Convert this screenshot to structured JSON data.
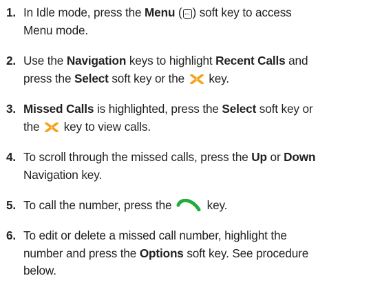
{
  "steps": [
    {
      "number": "1.",
      "t1": "In Idle mode, press the ",
      "b1": "Menu",
      "t2": " (",
      "t3": ") soft key to access",
      "t4": "Menu mode."
    },
    {
      "number": "2.",
      "t1": "Use the ",
      "b1": "Navigation",
      "t2": " keys to highlight ",
      "b2": "Recent Calls",
      "t3": " and",
      "t4": "press the ",
      "b3": "Select",
      "t5": " soft key or the ",
      "t6": " key."
    },
    {
      "number": "3.",
      "b1": "Missed Calls",
      "t1": " is highlighted, press the ",
      "b2": "Select",
      "t2": " soft key or",
      "t3": "the ",
      "t4": " key to view calls."
    },
    {
      "number": "4.",
      "t1": "To scroll through the missed calls, press the ",
      "b1": "Up",
      "t2": " or ",
      "b2": "Down",
      "t3": "Navigation key."
    },
    {
      "number": "5.",
      "t1": "To call the number, press the ",
      "t2": " key."
    },
    {
      "number": "6.",
      "t1": "To edit or delete a missed call number, highlight the",
      "t2": "number and press the ",
      "b1": "Options",
      "t3": " soft key. See procedure",
      "t4": "below."
    }
  ],
  "icons": {
    "menu_key": "menu-soft-key-icon",
    "nav_key": "navigation-center-key-icon",
    "send_key": "send-call-key-icon"
  },
  "colors": {
    "nav_key": "#f7a21b",
    "send_key": "#1fae3a",
    "text": "#231f20"
  }
}
